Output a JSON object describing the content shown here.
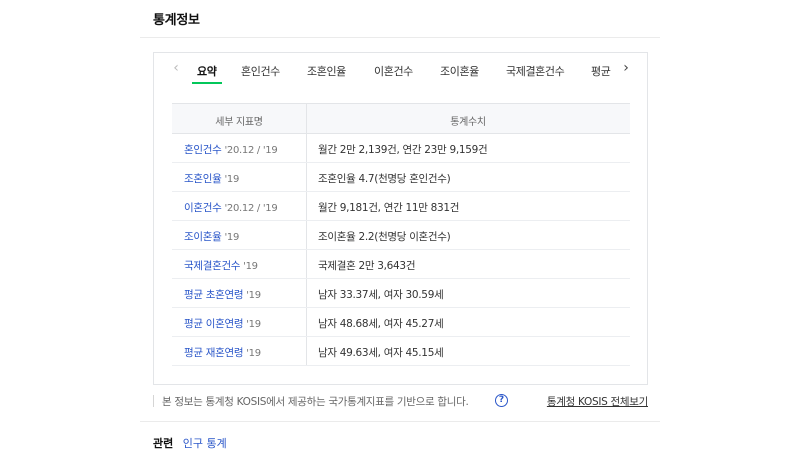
{
  "section": {
    "title": "통계정보"
  },
  "tabs": {
    "items": [
      "요약",
      "혼인건수",
      "조혼인율",
      "이혼건수",
      "조이혼율",
      "국제결혼건수",
      "평균"
    ],
    "active_index": 0,
    "accent_color": "#03c75a"
  },
  "table": {
    "headers": [
      "세부 지표명",
      "통계수치"
    ],
    "rows": [
      {
        "name": "혼인건수",
        "period": "'20.12 / '19",
        "value": "월간 2만 2,139건, 연간 23만 9,159건"
      },
      {
        "name": "조혼인율",
        "period": "'19",
        "value": "조혼인율 4.7(천명당 혼인건수)"
      },
      {
        "name": "이혼건수",
        "period": "'20.12 / '19",
        "value": "월간 9,181건, 연간 11만 831건"
      },
      {
        "name": "조이혼율",
        "period": "'19",
        "value": "조이혼율 2.2(천명당 이혼건수)"
      },
      {
        "name": "국제결혼건수",
        "period": "'19",
        "value": "국제결혼 2만 3,643건"
      },
      {
        "name": "평균 초혼연령",
        "period": "'19",
        "value": "남자 33.37세, 여자 30.59세"
      },
      {
        "name": "평균 이혼연령",
        "period": "'19",
        "value": "남자 48.68세, 여자 45.27세"
      },
      {
        "name": "평균 재혼연령",
        "period": "'19",
        "value": "남자 49.63세, 여자 45.15세"
      }
    ]
  },
  "notice": {
    "text": "본 정보는 통계청 KOSIS에서 제공하는 국가통계지표를 기반으로 합니다.",
    "help_icon": "question-circle-icon",
    "help_glyph": "?",
    "link_label": "통계청 KOSIS 전체보기"
  },
  "related": {
    "label": "관련",
    "link": "인구 통계"
  },
  "icons": {
    "prev": "‹",
    "next": "›"
  }
}
